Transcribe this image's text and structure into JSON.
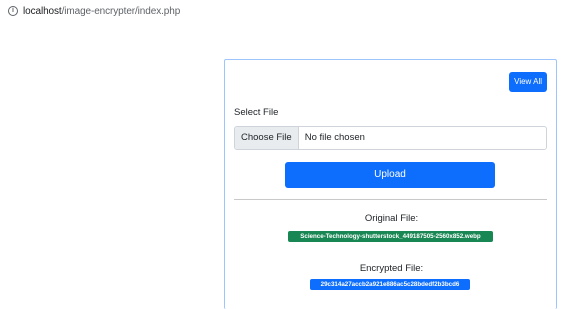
{
  "browser": {
    "url_host": "localhost",
    "url_path": "/image-encrypter/index.php"
  },
  "card": {
    "view_all_label": "View All",
    "select_file_label": "Select File",
    "file_input": {
      "button_label": "Choose File",
      "status_text": "No file chosen"
    },
    "upload_label": "Upload",
    "original_file_label": "Original File:",
    "original_file_name": "Science-Technology-shutterstock_449187505-2560x852.webp",
    "encrypted_file_label": "Encrypted File:",
    "encrypted_file_name": "29c314a27accb2a921e886ac5c28bdedf2b3bcd6"
  },
  "colors": {
    "primary": "#0d6efd",
    "success": "#198754",
    "card_border": "#9ec5fe"
  }
}
